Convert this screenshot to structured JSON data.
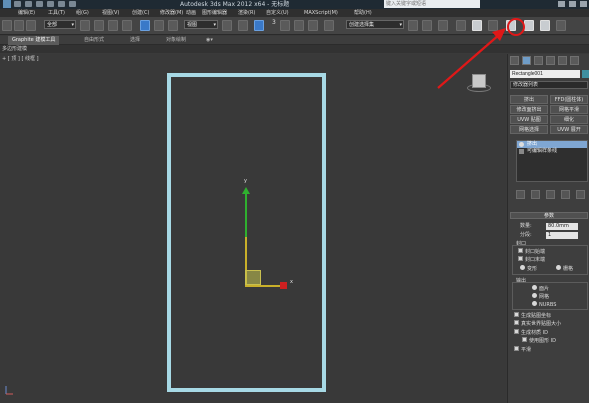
{
  "titlebar": {
    "title": "Autodesk 3ds Max 2012 x64 - 无标题",
    "search_placeholder": "键入关键字或短语"
  },
  "menus": [
    "编辑(E)",
    "工具(T)",
    "组(G)",
    "视图(V)",
    "创建(C)",
    "修改器(M)",
    "动画",
    "图形编辑器",
    "渲染(R)",
    "自定义(U)",
    "MAXScript(M)",
    "帮助(H)"
  ],
  "toolbar": {
    "select_filter": "全部",
    "coord_system": "视图",
    "named_selection": "创建选择集",
    "number_label": "3"
  },
  "ribbon": {
    "tabs": [
      "Graphite 建模工具",
      "自由形式",
      "选择",
      "对象绘制"
    ],
    "sub_label": "多边形建模"
  },
  "viewport": {
    "label": "+ [ 顶 ] [ 线框 ]",
    "axis_x": "x",
    "axis_y": "y"
  },
  "command_panel": {
    "object_name": "Rectangle001",
    "modifier_list": "修改器列表",
    "modifier_buttons": [
      "挤出",
      "FFD(圆柱体)",
      "修改面挤出",
      "网格平滑",
      "UVW 贴图",
      "细化",
      "网格选择",
      "UVW 展开"
    ],
    "stack": [
      "挤出",
      "可编辑样条线"
    ],
    "params_header": "参数",
    "amount_label": "数量:",
    "amount_value": "80.0mm",
    "segments_label": "分段:",
    "segments_value": "1",
    "capping_label": "封口",
    "cap_start": "封口始端",
    "cap_end": "封口末端",
    "morph": "变形",
    "grid": "栅格",
    "output_label": "输出",
    "patch": "面片",
    "mesh": "网格",
    "nurbs": "NURBS",
    "gen_map_coords": "生成贴图坐标",
    "real_world": "真实世界贴图大小",
    "gen_mat_ids": "生成材质 ID",
    "use_shape_ids": "使用图形 ID",
    "smooth": "平滑"
  },
  "colors": {
    "rectangle": "#a7d9e5",
    "annotation": "#e01818"
  }
}
